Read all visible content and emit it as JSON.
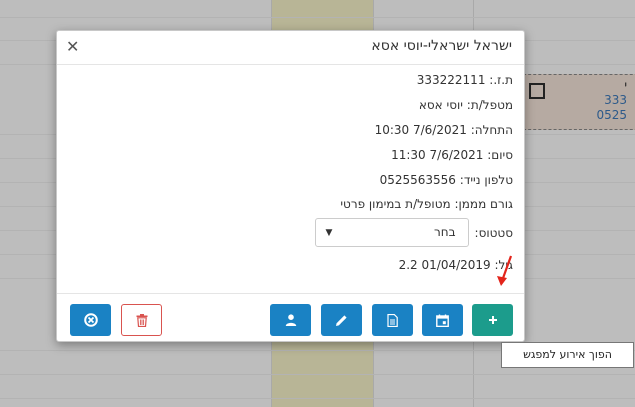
{
  "modal": {
    "title": "ישראל ישראלי-יוסי אסא",
    "fields": [
      {
        "label": "ת.ז.:",
        "value": "333222111"
      },
      {
        "label": "מטפל/ת:",
        "value": "יוסי אסא"
      },
      {
        "label": "התחלה:",
        "value": "7/6/2021 10:30"
      },
      {
        "label": "סיום:",
        "value": "7/6/2021 11:30"
      },
      {
        "label": "טלפון נייד:",
        "value": "0525563556"
      },
      {
        "label": "גורם מממן:",
        "value": "מטופל/ת במימון פרטי"
      }
    ],
    "status_label": "סטטוס:",
    "status_value": "בחר",
    "age_label": "גיל:",
    "age_value": "01/04/2019 2.2"
  },
  "tooltip": "הפוך אירוע למפגש",
  "background_event": {
    "line1": "י",
    "line2": "333",
    "line3": "0525"
  },
  "icons": {
    "close": "close-icon",
    "add": "plus-icon",
    "calendar": "calendar-icon",
    "document": "document-icon",
    "edit": "pencil-icon",
    "user": "user-icon",
    "delete": "trash-icon",
    "cancel": "cancel-circle-icon"
  },
  "colors": {
    "primary": "#1a82c4",
    "convert": "#1c9c8c",
    "danger": "#d9534f"
  }
}
